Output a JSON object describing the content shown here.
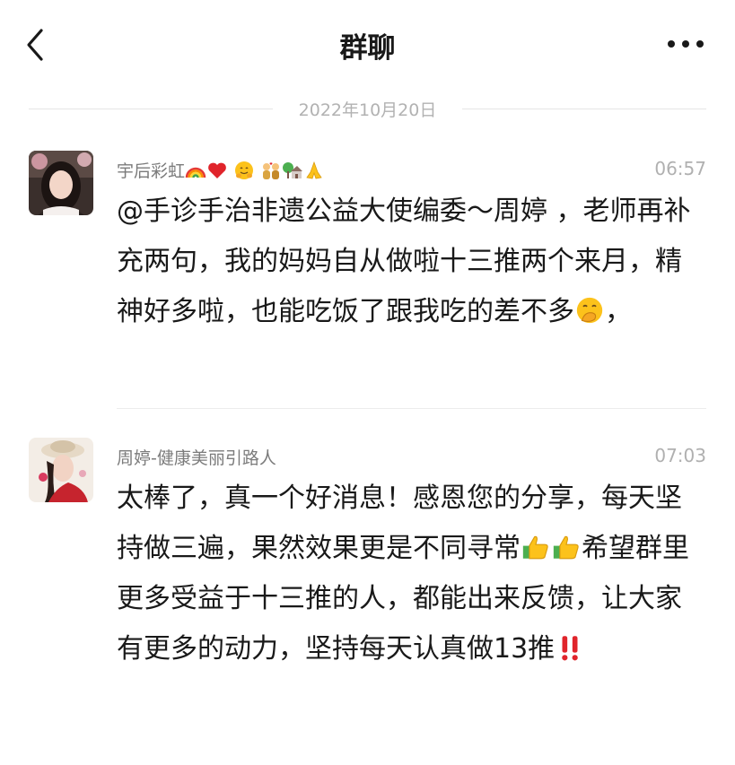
{
  "header": {
    "title": "群聊",
    "back_icon": "chevron-left-icon",
    "more_icon": "more-horizontal-icon"
  },
  "date_separator": "2022年10月20日",
  "messages": [
    {
      "sender_text": "宇后彩虹",
      "sender_emojis": [
        "rainbow-emoji",
        "red-heart-emoji",
        "hugging-face-emoji",
        "couple-with-heart-emoji",
        "house-with-tree-emoji",
        "folded-hands-emoji"
      ],
      "time": "06:57",
      "content_text": "@手诊手治非遗公益大使编委～周婷 ，老师再补充两句，我的妈妈自从做啦十三推两个来月，精神好多啦，也能吃饭了跟我吃的差不多",
      "content_tail_emoji": "face-with-hand-over-mouth-emoji",
      "content_tail_text": "，"
    },
    {
      "sender_text": "周婷-健康美丽引路人",
      "time": "07:03",
      "content_text_1": "太棒了，真一个好消息！感恩您的分享，每天坚持做三遍，果然效果更是不同寻常",
      "content_mid_emojis": [
        "thumbs-up-emoji",
        "thumbs-up-emoji"
      ],
      "content_text_2": "希望群里更多受益于十三推的人，都能出来反馈，让大家有更多的动力，坚持每天认真做13推",
      "content_tail_emoji": "double-exclamation-emoji"
    }
  ],
  "colors": {
    "text_primary": "#191919",
    "text_secondary": "#7b7b7b",
    "timestamp": "#b0b0b0",
    "divider": "#ececec",
    "background": "#ffffff"
  }
}
